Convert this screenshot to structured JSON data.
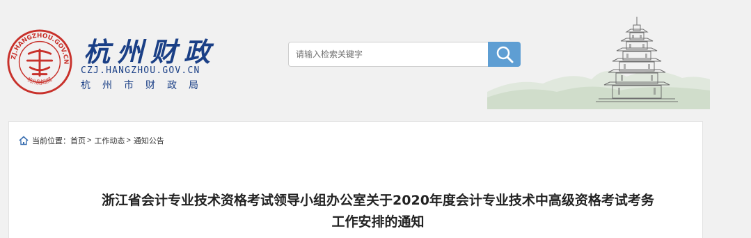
{
  "header": {
    "brand_title": "杭州财政",
    "brand_domain": "CZJ.HANGZHOU.GOV.CN",
    "brand_subtitle": "杭州市财政局",
    "seal_text_top": "CZJ.HANGZHOU.GOV.CN",
    "seal_text_bottom": "杭州财政局"
  },
  "search": {
    "placeholder": "请输入检索关键字",
    "value": ""
  },
  "breadcrumb": {
    "prefix": "当前位置：",
    "items": [
      "首页",
      "工作动态",
      "通知公告"
    ],
    "separator": ">"
  },
  "article": {
    "title_line1": "浙江省会计专业技术资格考试领导小组办公室关于2020年度会计专业技术中高级资格考试考务",
    "title_line2": "工作安排的通知"
  },
  "colors": {
    "brand_blue": "#1a3f86",
    "seal_red": "#c8312b",
    "search_button": "#5e9ed3",
    "page_background": "#f1f1f1"
  },
  "icons": {
    "search": "magnifier-icon",
    "breadcrumb_home": "home-icon",
    "logo": "seal-logo-icon",
    "banner": "pagoda-illustration"
  }
}
